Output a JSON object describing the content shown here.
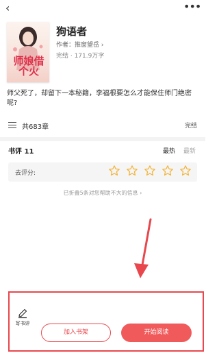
{
  "book": {
    "title": "狗语者",
    "cover_title": "师娘借个火",
    "author_label": "作者：",
    "author": "推窗望岳",
    "author_chevron": "›",
    "word_count": "完结 · 171.9万字",
    "description": "师父死了，却留下一本秘籍，李福根要怎么才能保住师门绝密呢?"
  },
  "chapters": {
    "count_label": "共683章",
    "status": "完结"
  },
  "reviews": {
    "title": "书评 11",
    "sort_hot": "最热",
    "sort_new": "最新",
    "rate_label": "去评分:",
    "rating": 0,
    "max_rating": 5,
    "folded_info": "已折叠5条对您帮助不大的信息 ›"
  },
  "bottom_bar": {
    "write_review": "写书评",
    "add_to_shelf": "加入书架",
    "start_reading": "开始阅读"
  },
  "icons": {
    "back": "‹",
    "more": "•••"
  },
  "colors": {
    "accent": "#e8474d",
    "read_button": "#f05a5a",
    "star": "#f2b233"
  }
}
